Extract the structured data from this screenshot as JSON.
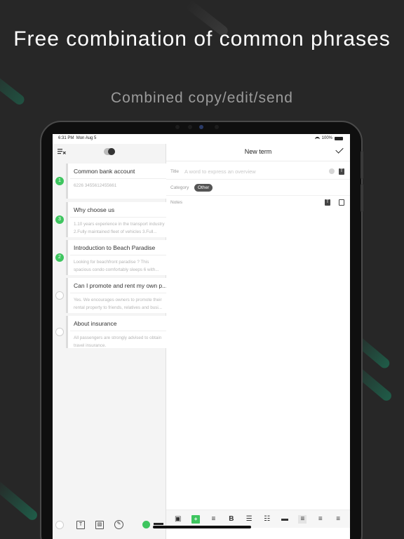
{
  "hero": {
    "title": "Free combination of common phrases",
    "subtitle": "Combined copy/edit/send"
  },
  "status_bar": {
    "time": "6:31 PM",
    "date": "Mon Aug 5",
    "battery": "100%"
  },
  "list": {
    "items": [
      {
        "number": "1",
        "title": "Common bank account",
        "line1": "6226 3455612455661",
        "line2": "",
        "selected": true
      },
      {
        "number": "3",
        "title": "Why choose us",
        "line1": "1.10 years experience in the transport industry",
        "line2": "2.Fully maintained fleet of vehicles  3.Full...",
        "selected": true
      },
      {
        "number": "2",
        "title": "Introduction to Beach Paradise",
        "line1": "Looking for beachfront paradise ? This",
        "line2": "spacious condo comfortably sleeps 6 with...",
        "selected": true
      },
      {
        "number": "",
        "title": "Can I promote and rent my own p...",
        "line1": "Yes. We encourages owners to promote their",
        "line2": "rental property to friends, relatives and busi...",
        "selected": false
      },
      {
        "number": "",
        "title": "About insurance",
        "line1": "All passengers are strongly advised to obtain",
        "line2": "travel insurance.",
        "selected": false
      }
    ]
  },
  "editor": {
    "nav_title": "New term",
    "title_label": "Title",
    "title_placeholder": "A word to express an overview",
    "category_label": "Category",
    "category_value": "Other",
    "notes_label": "Notes",
    "t_glyph": "T"
  },
  "left_toolbar": {
    "text_glyph": "T",
    "image_glyph": "▧",
    "pen_glyph": "✎"
  },
  "format_toolbar": {
    "buttons": [
      "▣",
      "+",
      "≡",
      "B",
      "☰",
      "☷",
      "▬",
      "≡",
      "≡",
      "≡"
    ]
  },
  "colors": {
    "accent": "#3ec55f",
    "background": "#272727",
    "chip": "#555555"
  }
}
